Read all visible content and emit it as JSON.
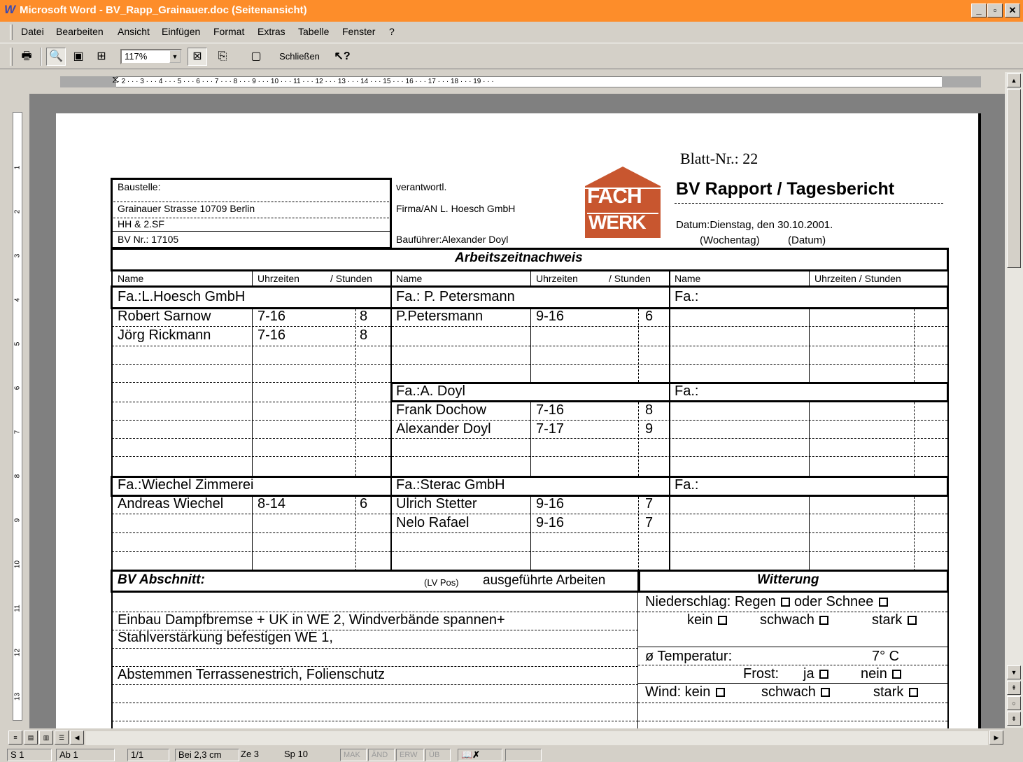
{
  "window": {
    "title": "Microsoft Word - BV_Rapp_Grainauer.doc (Seitenansicht)"
  },
  "menu": [
    "Datei",
    "Bearbeiten",
    "Ansicht",
    "Einfügen",
    "Format",
    "Extras",
    "Tabelle",
    "Fenster",
    "?"
  ],
  "toolbar": {
    "zoom": "117%",
    "close_label": "Schließen"
  },
  "status": {
    "section": "S 1",
    "page": "Ab 1",
    "pages": "1/1",
    "position": "Bei 2,3 cm",
    "line": "Ze 3",
    "column": "Sp 10",
    "mak": "MAK",
    "aend": "ÄND",
    "erw": "ERW",
    "ueb": "ÜB"
  },
  "ruler": {
    "h": "· 1 · · · ⌂ · · · 1 · · · 2 · · · 3 · · · 4 · · · 5 · · · 6 · · · 7 · · · 8 · · · 9 · · · 10 · · · 11 · · · 12 · · · 13 · · · 14 · · · 15 · · · 16 · · · 17 · · · 18 · · · 19 · · ·",
    "v": [
      "1",
      "2",
      "3",
      "4",
      "5",
      "6",
      "7",
      "8",
      "9",
      "10",
      "11",
      "12",
      "13"
    ]
  },
  "doc": {
    "blatt": "Blatt-Nr.: 22",
    "header_title": "BV Rapport / Tagesbericht",
    "datum": "Datum:Dienstag, den 30.10.2001.",
    "wochentag": "(Wochentag)",
    "datum_hint": "(Datum)",
    "logo_top": "FACH",
    "logo_bottom": "WERK",
    "baustelle_label": "Baustelle:",
    "baustelle_line1": "Grainauer Strasse 10709 Berlin",
    "baustelle_line2": "HH & 2.SF",
    "bv_nr": "BV Nr.: 17105",
    "verantwortl": "verantwortl.",
    "firma": "Firma/AN L. Hoesch GmbH",
    "bauleiter": "Bauführer:Alexander Doyl",
    "section_title": "Arbeitszeitnachweis",
    "col_name": "Name",
    "col_uhr": "Uhrzeiten",
    "col_std": "/ Stunden",
    "col_uhrstd": "Uhrzeiten / Stunden",
    "firm_hoesch": "Fa.:L.Hoesch GmbH",
    "firm_petersmann": "Fa.: P. Petersmann",
    "firm_empty": "Fa.:",
    "firm_doyl": "Fa.:A. Doyl",
    "firm_wiechel": "Fa.:Wiechel Zimmerei",
    "firm_sterac": "Fa.:Sterac GmbH",
    "w1": {
      "name": "Robert Sarnow",
      "time": "7-16",
      "hours": "8"
    },
    "w2": {
      "name": "Jörg Rickmann",
      "time": "7-16",
      "hours": "8"
    },
    "w3": {
      "name": "P.Petersmann",
      "time": "9-16",
      "hours": "6"
    },
    "w4": {
      "name": "Frank Dochow",
      "time": "7-16",
      "hours": "8"
    },
    "w5": {
      "name": "Alexander Doyl",
      "time": "7-17",
      "hours": "9"
    },
    "w6": {
      "name": "Andreas Wiechel",
      "time": "8-14",
      "hours": "6"
    },
    "w7": {
      "name": "Ulrich Stetter",
      "time": "9-16",
      "hours": "7"
    },
    "w8": {
      "name": "Nelo Rafael",
      "time": "9-16",
      "hours": "7"
    },
    "bv_abschnitt": "BV Abschnitt:",
    "lv_pos": "(LV Pos)",
    "ausgef": "ausgeführte Arbeiten",
    "witterung": "Witterung",
    "work1": "Einbau Dampfbremse + UK in WE 2, Windverbände spannen+",
    "work2": "Stahlverstärkung befestigen WE 1,",
    "work3": "Abstemmen Terrassenestrich, Folienschutz",
    "nieder": "Niederschlag: Regen",
    "oder_schnee": "oder Schnee",
    "kein": "kein",
    "schwach": "schwach",
    "stark": "stark",
    "temp_label": "ø  Temperatur:",
    "temp_val": "7° C",
    "frost": "Frost:",
    "ja": "ja",
    "nein": "nein",
    "wind": "Wind: kein"
  }
}
